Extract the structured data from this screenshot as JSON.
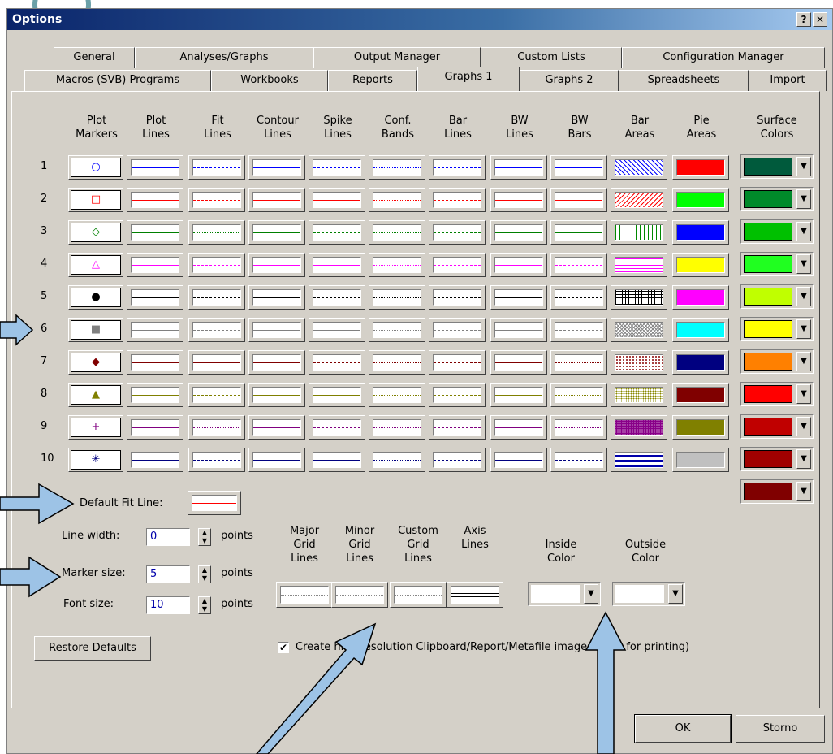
{
  "window": {
    "title": "Options",
    "help": "?",
    "close": "✕"
  },
  "tabs_row1": [
    "General",
    "Analyses/Graphs",
    "Output Manager",
    "Custom Lists",
    "Configuration Manager"
  ],
  "tabs_row2": [
    "Macros (SVB) Programs",
    "Workbooks",
    "Reports",
    "Graphs 1",
    "Graphs 2",
    "Spreadsheets",
    "Import"
  ],
  "columns": [
    "Plot\nMarkers",
    "Plot\nLines",
    "Fit\nLines",
    "Contour\nLines",
    "Spike\nLines",
    "Conf.\nBands",
    "Bar\nLines",
    "BW\nLines",
    "BW\nBars",
    "Bar\nAreas",
    "Pie\nAreas",
    "Surface\nColors"
  ],
  "row_labels": [
    "1",
    "2",
    "3",
    "4",
    "5",
    "6",
    "7",
    "8",
    "9",
    "10"
  ],
  "markers": [
    {
      "glyph": "○",
      "color": "#0000ff"
    },
    {
      "glyph": "□",
      "color": "#ff0000"
    },
    {
      "glyph": "◇",
      "color": "#008000"
    },
    {
      "glyph": "△",
      "color": "#ff00ff"
    },
    {
      "glyph": "●",
      "color": "#000000"
    },
    {
      "glyph": "■",
      "color": "#808080"
    },
    {
      "glyph": "◆",
      "color": "#800000"
    },
    {
      "glyph": "▲",
      "color": "#808000"
    },
    {
      "glyph": "+",
      "color": "#800080"
    },
    {
      "glyph": "✳",
      "color": "#000080"
    }
  ],
  "row_colors": [
    "#0000ff",
    "#ff0000",
    "#008000",
    "#ff00ff",
    "#000000",
    "#808080",
    "#800000",
    "#808000",
    "#800080",
    "#000080"
  ],
  "pie_colors": [
    "#ff0000",
    "#00ff00",
    "#0000ff",
    "#ffff00",
    "#ff00ff",
    "#00ffff",
    "#000080",
    "#800000",
    "#808000",
    "#c0c0c0"
  ],
  "surface_colors": [
    "#005a3c",
    "#008a2a",
    "#00c000",
    "#20ff20",
    "#c0ff00",
    "#ffff00",
    "#ff8000",
    "#ff0000",
    "#c00000",
    "#a00000",
    "#800000"
  ],
  "default_fit_line": {
    "label": "Default Fit Line:",
    "color": "#ff0000"
  },
  "settings": [
    {
      "label": "Line width:",
      "value": "0",
      "unit": "points"
    },
    {
      "label": "Marker size:",
      "value": "5",
      "unit": "points"
    },
    {
      "label": "Font size:",
      "value": "10",
      "unit": "points"
    }
  ],
  "grid_columns": [
    "Major\nGrid\nLines",
    "Minor\nGrid\nLines",
    "Custom\nGrid\nLines",
    "Axis\nLines",
    "Inside\nColor",
    "Outside\nColor"
  ],
  "restore_button": "Restore Defaults",
  "checkbox_label": "Create high resolution Clipboard/Report/Metafile images (best for printing)",
  "checkbox_checked": "✔",
  "ok_button": "OK",
  "cancel_button": "Storno",
  "accent_color": "#9dc3e6"
}
